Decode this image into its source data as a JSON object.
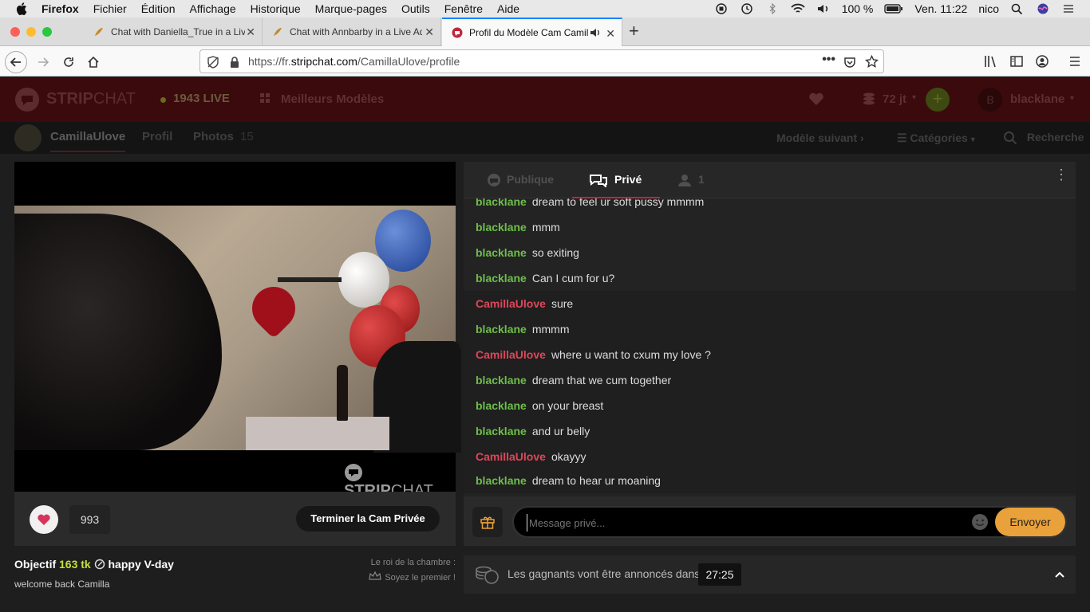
{
  "os_menubar": {
    "app": "Firefox",
    "items": [
      "Fichier",
      "Édition",
      "Affichage",
      "Historique",
      "Marque-pages",
      "Outils",
      "Fenêtre",
      "Aide"
    ],
    "battery": "100 %",
    "clock": "Ven. 11:22",
    "user": "nico"
  },
  "tabs": [
    {
      "label": "Chat with Daniella_True in a Live Ad"
    },
    {
      "label": "Chat with Annbarby in a Live Ad"
    },
    {
      "label": "Profil du Modèle Cam Camill"
    }
  ],
  "url": {
    "prefix": "https://fr.",
    "domain": "stripchat.com",
    "path": "/CamillaUlove/profile"
  },
  "site": {
    "logo_strip": "STRIP",
    "logo_chat": "CHAT",
    "live_count": "1943 LIVE",
    "top_models": "Meilleurs Modèles",
    "tokens": "72 jt",
    "username": "blacklane",
    "avatar_letter": "B"
  },
  "subnav": {
    "model_name": "CamillaUlove",
    "profile": "Profil",
    "photos": "Photos",
    "photos_count": "15",
    "next_model": "Modèle suivant",
    "categories": "Catégories",
    "search": "Recherche"
  },
  "video": {
    "watermark_strip": "STRIP",
    "watermark_chat": "CHAT",
    "likes": "993",
    "end_private_button": "Terminer la Cam Privée"
  },
  "chat": {
    "tab_public": "Publique",
    "tab_private": "Privé",
    "viewers": "1",
    "messages": [
      {
        "user": "blacklane",
        "text": "dream to feel ur soft pussy mmmm",
        "role": "viewer"
      },
      {
        "user": "blacklane",
        "text": "mmm",
        "role": "viewer"
      },
      {
        "user": "blacklane",
        "text": "so exiting",
        "role": "viewer"
      },
      {
        "user": "blacklane",
        "text": "Can I cum for u?",
        "role": "viewer"
      },
      {
        "user": "CamillaUlove",
        "text": "sure",
        "role": "model"
      },
      {
        "user": "blacklane",
        "text": "mmmm",
        "role": "viewer"
      },
      {
        "user": "CamillaUlove",
        "text": "where u want to cxum my love ?",
        "role": "model"
      },
      {
        "user": "blacklane",
        "text": "dream that we cum together",
        "role": "viewer"
      },
      {
        "user": "blacklane",
        "text": "on your breast",
        "role": "viewer"
      },
      {
        "user": "blacklane",
        "text": "and ur belly",
        "role": "viewer"
      },
      {
        "user": "CamillaUlove",
        "text": "okayyy",
        "role": "model"
      },
      {
        "user": "blacklane",
        "text": "dream to hear ur moaning",
        "role": "viewer"
      }
    ],
    "input_placeholder": "Message privé...",
    "send_button": "Envoyer"
  },
  "goal": {
    "label": "Objectif",
    "amount": "163 tk",
    "title": "happy V-day",
    "subtitle": "welcome back Camilla",
    "king_label": "Le roi de la chambre :",
    "king_value": "Soyez le premier !"
  },
  "winners": {
    "text": "Les gagnants vont être annoncés dans",
    "timer": "27:25"
  },
  "colors": {
    "viewer_name": "#6ebe4a",
    "model_name": "#e0465a",
    "accent": "#e9a13b",
    "header_bg": "#3a0a0c"
  }
}
